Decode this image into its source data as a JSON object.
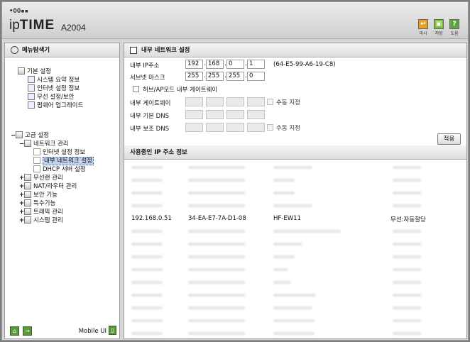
{
  "header": {
    "logo_dots": "•OO▪▪",
    "logo_prefix": "ip",
    "logo_bold": "TIME",
    "model": "A2004",
    "buttons": [
      {
        "label": "마시",
        "color": "#e8a02c",
        "icon": "exit-icon"
      },
      {
        "label": "저장",
        "color": "#7cbf3a",
        "icon": "save-icon"
      },
      {
        "label": "도움",
        "color": "#5ea53c",
        "icon": "help-icon"
      }
    ]
  },
  "sidebar": {
    "title": "메뉴탐색기",
    "basic": {
      "label": "기본 설정",
      "items": [
        "시스템 요약 정보",
        "인터넷 설정 정보",
        "무선 설정/보안",
        "펌웨어 업그레이드"
      ]
    },
    "advanced": {
      "label": "고급 설정",
      "network": {
        "label": "네트워크 관리",
        "items": [
          "인터넷 설정 정보",
          "내부 네트워크 설정",
          "DHCP 서버 설정"
        ]
      },
      "groups": [
        "무선랜 관리",
        "NAT/라우터 관리",
        "보안 기능",
        "특수기능",
        "트래픽 관리",
        "시스템 관리"
      ]
    },
    "footer": {
      "mobile": "Mobile UI"
    }
  },
  "main": {
    "title": "내부 네트워크 설정",
    "ip_label": "내부 IP주소",
    "ip": [
      "192",
      "168",
      "0",
      "1"
    ],
    "mac": "(64-E5-99-A6-19-C8)",
    "mask_label": "서브넷 마스크",
    "mask": [
      "255",
      "255",
      "255",
      "0"
    ],
    "hub_label": "허브/AP모드 내부 게이트웨이",
    "gw_label": "내부 게이트웨이",
    "manual_label": "수동 지정",
    "dns1_label": "내부 기본 DNS",
    "dns2_label": "내부 보조 DNS",
    "apply": "적용",
    "ip_section": "사용중인 IP 주소 정보",
    "visible_row": {
      "ip": "192.168.0.51",
      "mac": "34-EA-E7-7A-D1-08",
      "name": "HF-EW11",
      "type": "무선:자동할당"
    }
  }
}
